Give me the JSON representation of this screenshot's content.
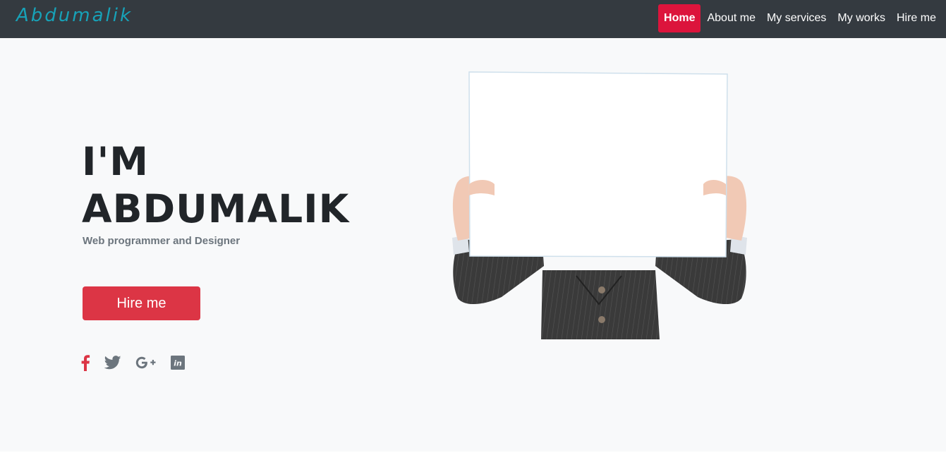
{
  "brand": "Abdumalik",
  "nav": {
    "items": [
      {
        "label": "Home",
        "active": true
      },
      {
        "label": "About me"
      },
      {
        "label": "My services"
      },
      {
        "label": "My works"
      },
      {
        "label": "Hire me"
      }
    ]
  },
  "hero": {
    "title_line1": "I'M",
    "title_line2": "ABDUMALIK",
    "subtitle": "Web programmer and Designer",
    "cta_label": "Hire me"
  },
  "social": [
    "facebook-icon",
    "twitter-icon",
    "google-plus-icon",
    "linkedin-icon"
  ],
  "colors": {
    "navbar": "#343a40",
    "brand": "#17a2b8",
    "nav_active": "#dc143c",
    "cta": "#dc3545",
    "hero_bg": "#f8f9fa",
    "title": "#212529",
    "subtitle": "#6c757d",
    "icon_muted": "#6c757d",
    "icon_accent": "#dc3545"
  }
}
